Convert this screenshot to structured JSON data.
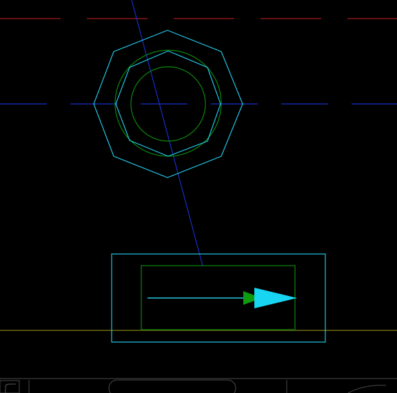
{
  "colors": {
    "background": "#000000",
    "cyan": "#22c7e6",
    "green": "#0c8a0c",
    "blue_centerline": "#1531c9",
    "red_centerline": "#a81a1a",
    "olive_line": "#6f6a12",
    "arrow_fill": "#18d6f2",
    "arrow_tail": "#0f9b0f",
    "ui_gray": "#4a4a4a"
  },
  "shapes": {
    "nut": {
      "outer": "octagon",
      "inner": "octagon",
      "circles": "concentric"
    },
    "lower_block": {
      "frame": "rectangle",
      "inner_frame": "rectangle",
      "arrow_direction": "right"
    }
  }
}
